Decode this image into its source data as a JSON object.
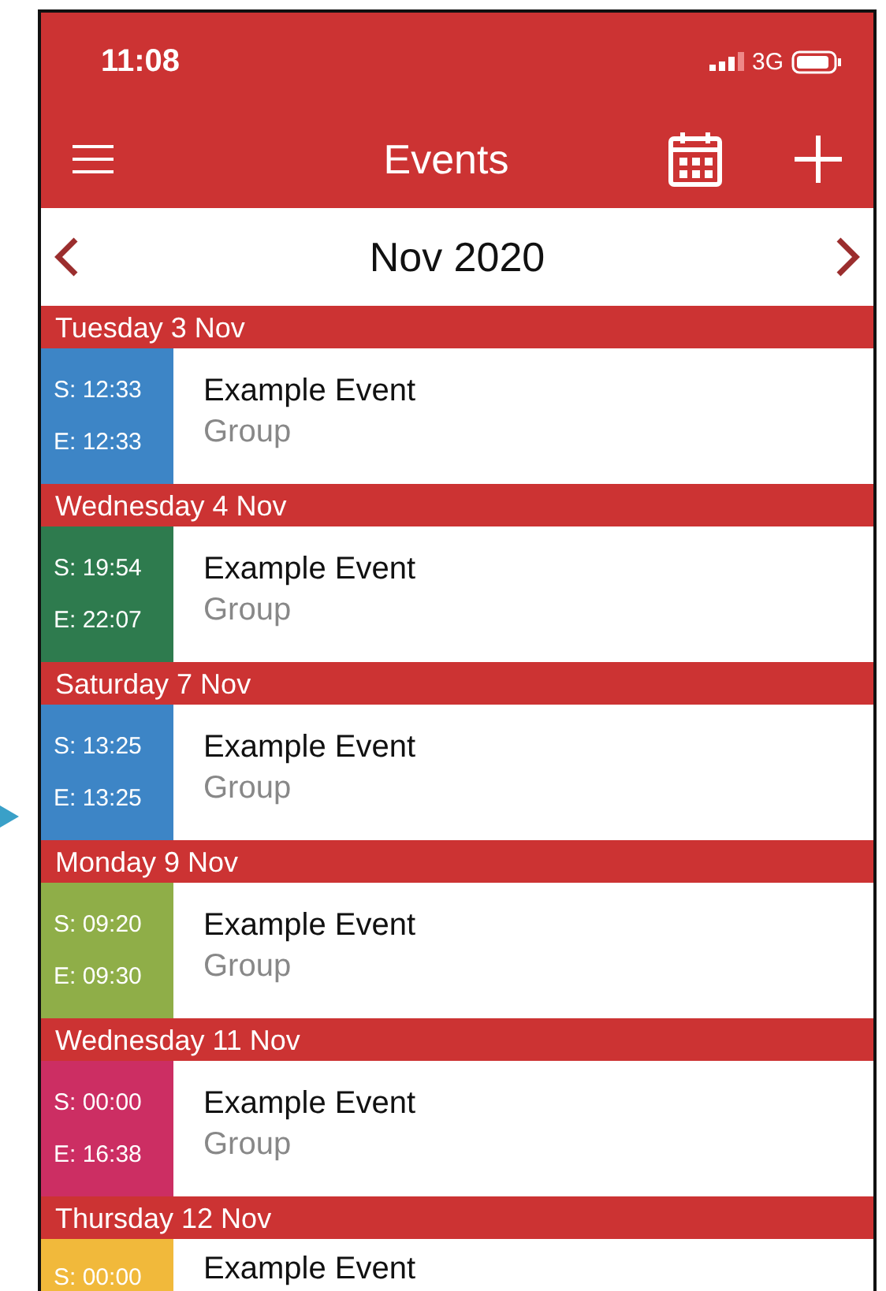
{
  "status_bar": {
    "time": "11:08",
    "network": "3G"
  },
  "nav_bar": {
    "title": "Events"
  },
  "month_bar": {
    "label": "Nov 2020"
  },
  "days": [
    {
      "label": "Tuesday 3 Nov",
      "events": [
        {
          "start": "S: 12:33",
          "end": "E: 12:33",
          "title": "Example Event",
          "group": "Group",
          "color": "#3d85c6"
        }
      ]
    },
    {
      "label": "Wednesday 4 Nov",
      "events": [
        {
          "start": "S: 19:54",
          "end": "E: 22:07",
          "title": "Example Event",
          "group": "Group",
          "color": "#2e7b4e"
        }
      ]
    },
    {
      "label": "Saturday 7 Nov",
      "events": [
        {
          "start": "S: 13:25",
          "end": "E: 13:25",
          "title": "Example Event",
          "group": "Group",
          "color": "#3d85c6"
        }
      ]
    },
    {
      "label": "Monday 9 Nov",
      "events": [
        {
          "start": "S: 09:20",
          "end": "E: 09:30",
          "title": "Example Event",
          "group": "Group",
          "color": "#8fae48"
        }
      ]
    },
    {
      "label": "Wednesday 11 Nov",
      "events": [
        {
          "start": "S: 00:00",
          "end": "E: 16:38",
          "title": "Example Event",
          "group": "Group",
          "color": "#cc2e63"
        }
      ]
    },
    {
      "label": "Thursday 12 Nov",
      "events": [
        {
          "start": "S: 00:00",
          "title": "Example Event",
          "color": "#f1b93b"
        }
      ]
    }
  ]
}
